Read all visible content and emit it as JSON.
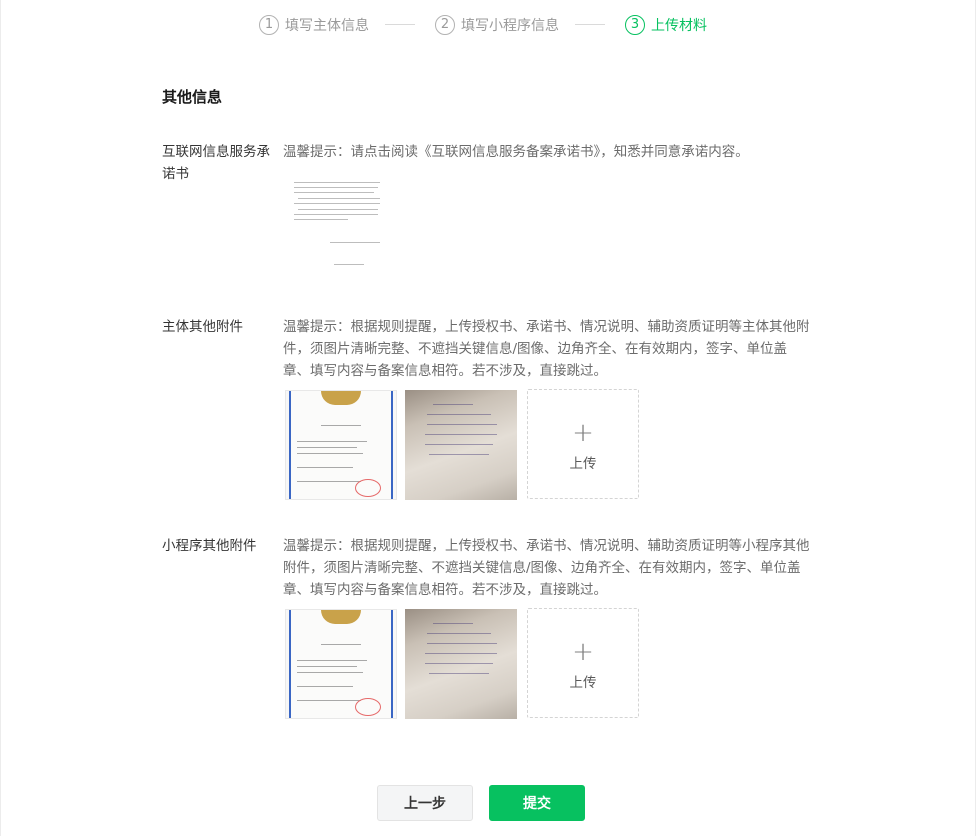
{
  "steps": [
    {
      "num": "1",
      "label": "填写主体信息",
      "state": "done"
    },
    {
      "num": "2",
      "label": "填写小程序信息",
      "state": "done"
    },
    {
      "num": "3",
      "label": "上传材料",
      "state": "active"
    }
  ],
  "section_title": "其他信息",
  "rows": {
    "commitment": {
      "label": "互联网信息服务承诺书",
      "tip": "温馨提示：请点击阅读《互联网信息服务备案承诺书》，知悉并同意承诺内容。"
    },
    "entity_attachments": {
      "label": "主体其他附件",
      "tip": "温馨提示：根据规则提醒，上传授权书、承诺书、情况说明、辅助资质证明等主体其他附件，须图片清晰完整、不遮挡关键信息/图像、边角齐全、在有效期内，签字、单位盖章、填写内容与备案信息相符。若不涉及，直接跳过。"
    },
    "miniprogram_attachments": {
      "label": "小程序其他附件",
      "tip": "温馨提示：根据规则提醒，上传授权书、承诺书、情况说明、辅助资质证明等小程序其他附件，须图片清晰完整、不遮挡关键信息/图像、边角齐全、在有效期内，签字、单位盖章、填写内容与备案信息相符。若不涉及，直接跳过。"
    }
  },
  "upload_label": "上传",
  "upload_icon": "plus-icon",
  "buttons": {
    "prev": "上一步",
    "submit": "提交"
  },
  "colors": {
    "accent": "#07c160",
    "muted": "#9a9a9a"
  }
}
